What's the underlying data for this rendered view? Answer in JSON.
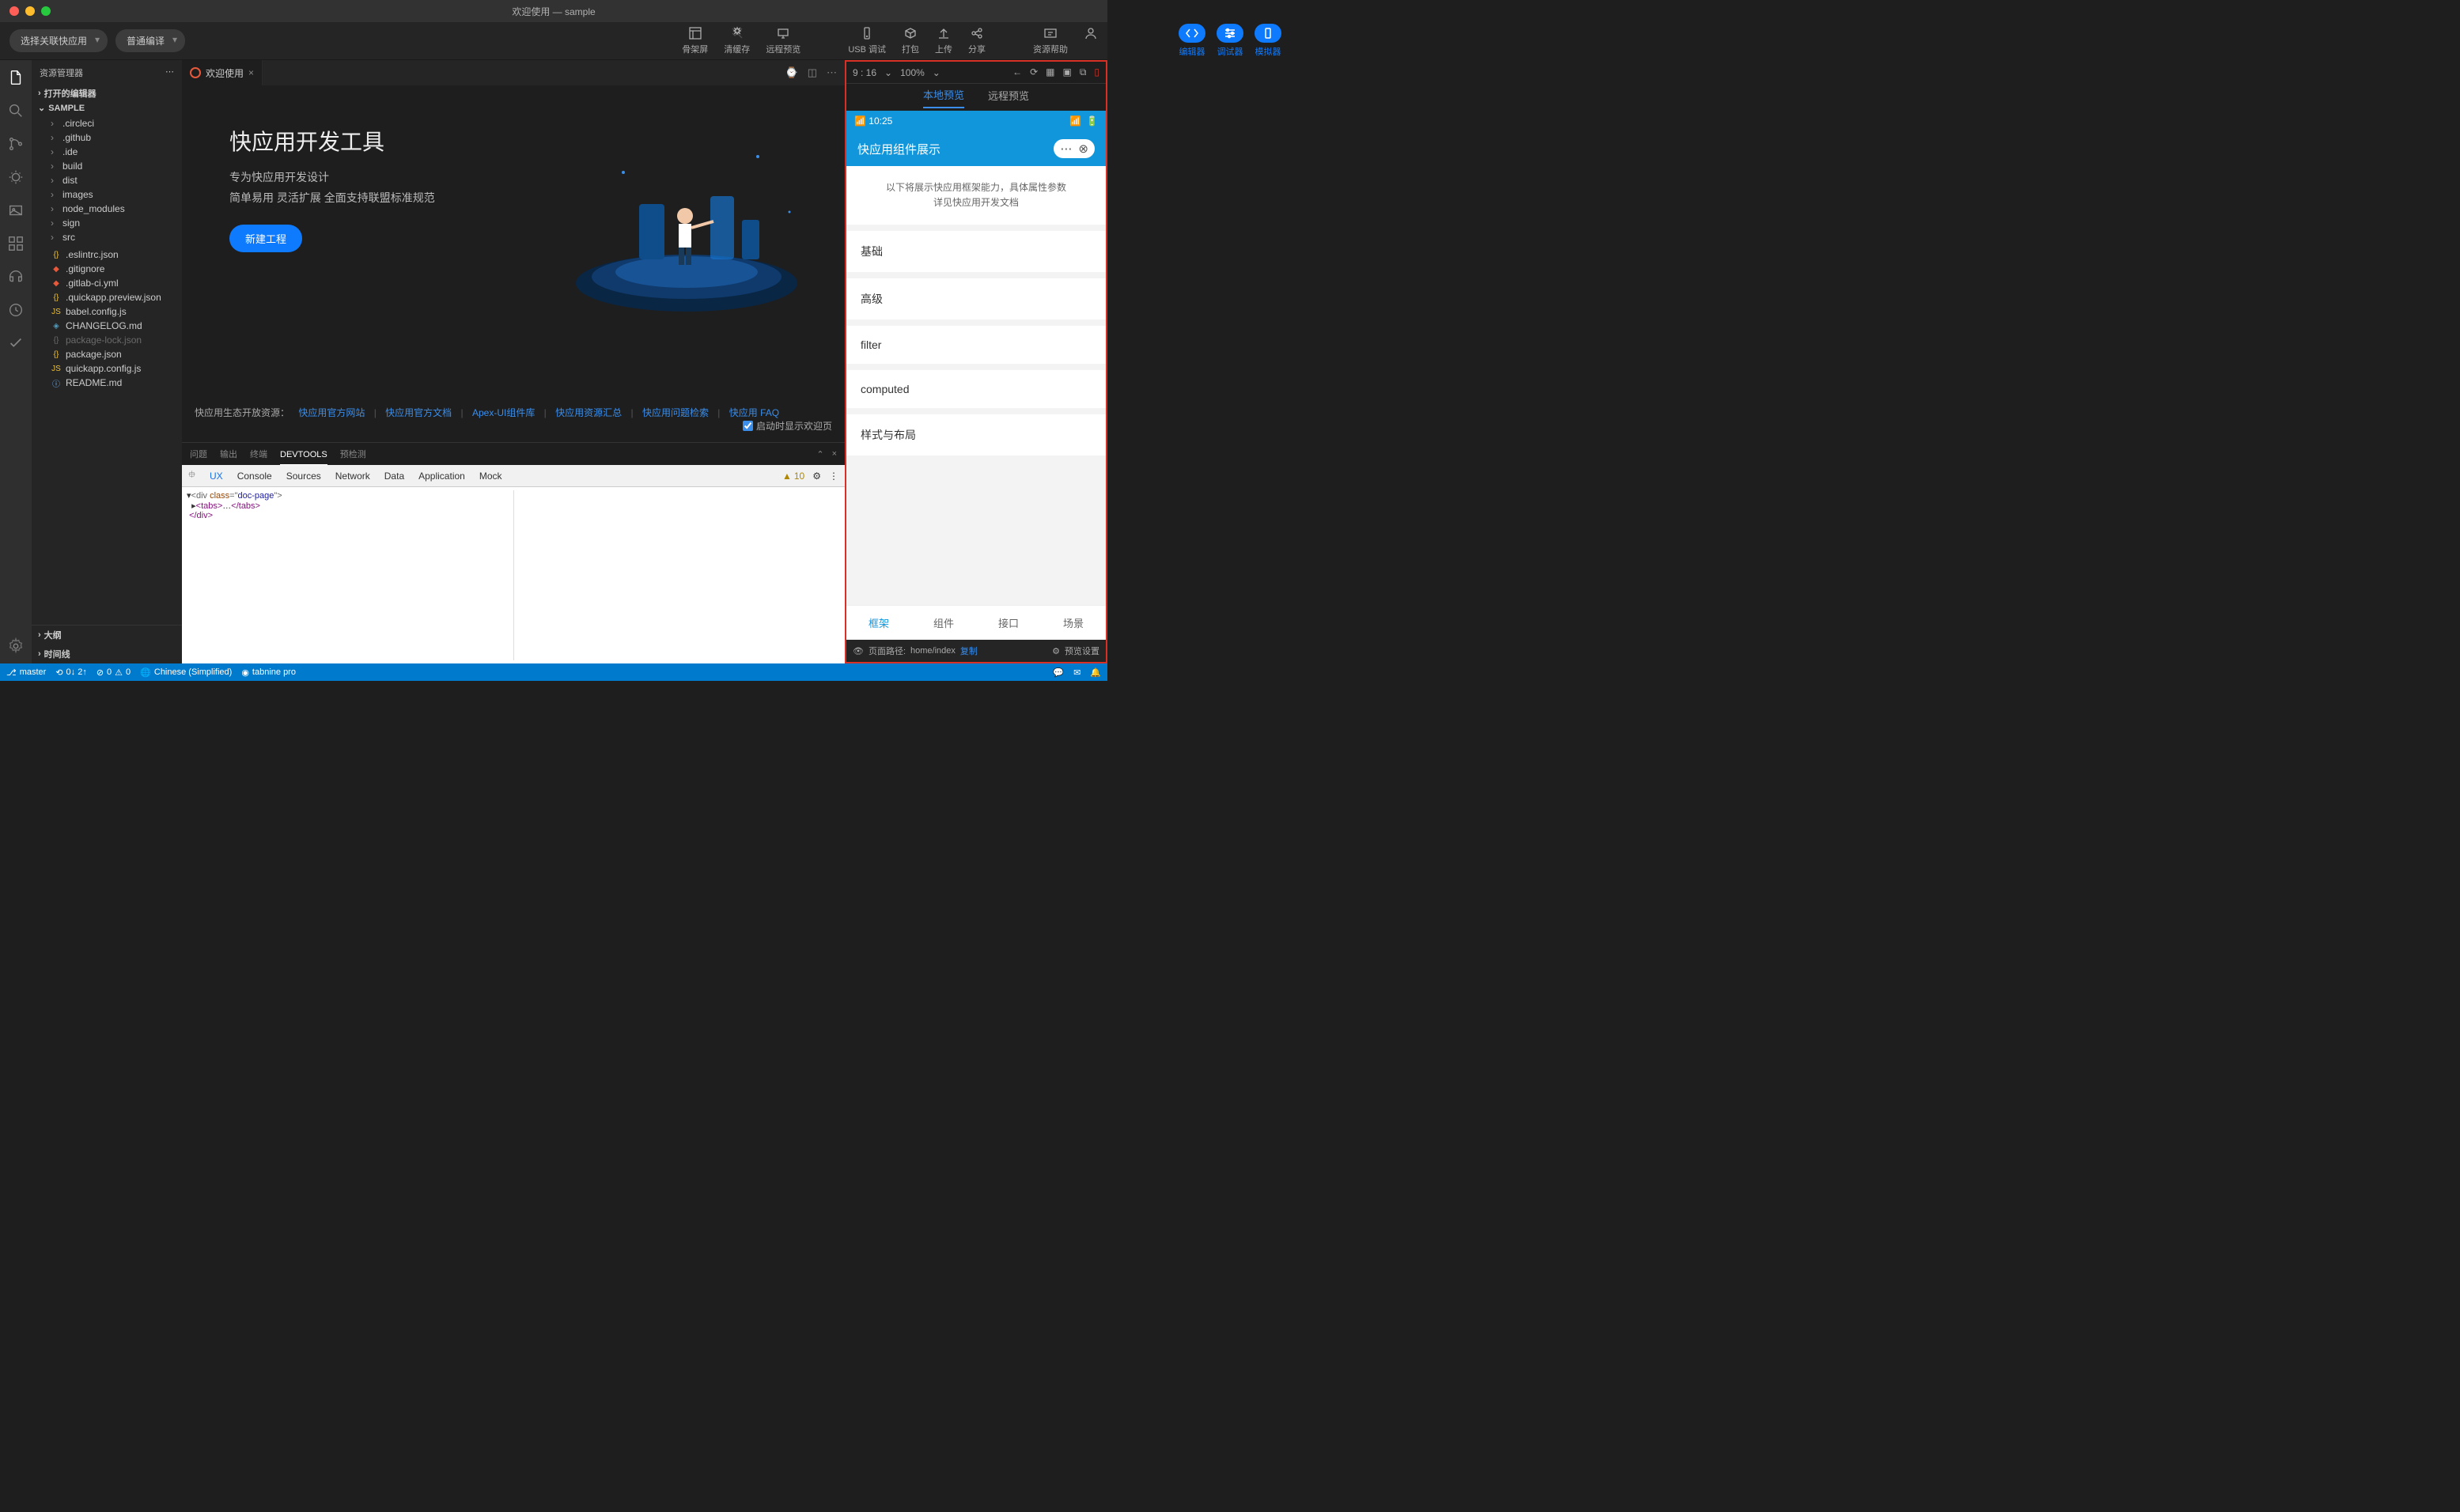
{
  "titlebar": {
    "title": "欢迎使用 — sample"
  },
  "toolbar": {
    "dropdown1": "选择关联快应用",
    "dropdown2": "普通编译",
    "modes": {
      "editor": "编辑器",
      "debugger": "调试器",
      "simulator": "模拟器"
    },
    "actions": {
      "skeleton": "骨架屏",
      "clear_cache": "清缓存",
      "remote_preview": "远程预览",
      "usb_debug": "USB 调试",
      "package": "打包",
      "upload": "上传",
      "share": "分享",
      "help": "资源帮助"
    }
  },
  "sidebar": {
    "title": "资源管理器",
    "open_editors": "打开的编辑器",
    "project": "SAMPLE",
    "folders": [
      ".circleci",
      ".github",
      ".ide",
      "build",
      "dist",
      "images",
      "node_modules",
      "sign",
      "src"
    ],
    "files": [
      {
        "n": ".eslintrc.json",
        "t": "json"
      },
      {
        "n": ".gitignore",
        "t": "git"
      },
      {
        "n": ".gitlab-ci.yml",
        "t": "git"
      },
      {
        "n": ".quickapp.preview.json",
        "t": "json"
      },
      {
        "n": "babel.config.js",
        "t": "js"
      },
      {
        "n": "CHANGELOG.md",
        "t": "md"
      },
      {
        "n": "package-lock.json",
        "t": "json",
        "dim": true
      },
      {
        "n": "package.json",
        "t": "json"
      },
      {
        "n": "quickapp.config.js",
        "t": "js"
      },
      {
        "n": "README.md",
        "t": "info"
      }
    ],
    "outline": "大纲",
    "timeline": "时间线"
  },
  "tabs": {
    "welcome": "欢迎使用"
  },
  "welcome": {
    "heading": "快应用开发工具",
    "line1": "专为快应用开发设计",
    "line2": "简单易用 灵活扩展 全面支持联盟标准规范",
    "button": "新建工程",
    "resources_label": "快应用生态开放资源：",
    "links": [
      "快应用官方网站",
      "快应用官方文档",
      "Apex-UI组件库",
      "快应用资源汇总",
      "快应用问题检索",
      "快应用 FAQ"
    ],
    "startup": "启动时显示欢迎页"
  },
  "panel": {
    "tabs": [
      "问题",
      "输出",
      "终端",
      "DEVTOOLS",
      "预检测"
    ],
    "devtools_tabs": [
      "UX",
      "Console",
      "Sources",
      "Network",
      "Data",
      "Application",
      "Mock"
    ],
    "warn_count": "10",
    "dom": {
      "l1_a": "<div ",
      "l1_b": "class",
      "l1_c": "=\"",
      "l1_d": "doc-page",
      "l1_e": "\">",
      "l2_a": "<tabs>",
      "l2_b": "…",
      "l2_c": "</tabs>",
      "l3": "</div>"
    }
  },
  "preview": {
    "ratio": "9 : 16",
    "zoom": "100%",
    "tabs": {
      "local": "本地预览",
      "remote": "远程预览"
    },
    "phone": {
      "time": "10:25",
      "title": "快应用组件展示",
      "desc1": "以下将展示快应用框架能力，具体属性参数",
      "desc2": "详见快应用开发文档",
      "items": [
        "基础",
        "高级",
        "filter",
        "computed",
        "样式与布局"
      ],
      "tabbar": [
        "框架",
        "组件",
        "接口",
        "场景"
      ]
    },
    "path_label": "页面路径: ",
    "path": "home/index",
    "copy": "复制",
    "settings": "预览设置"
  },
  "status": {
    "branch": "master",
    "sync": "0↓ 2↑",
    "errors": "0",
    "warnings": "0",
    "lang": "Chinese (Simplified)",
    "tabnine": "tabnine pro"
  }
}
